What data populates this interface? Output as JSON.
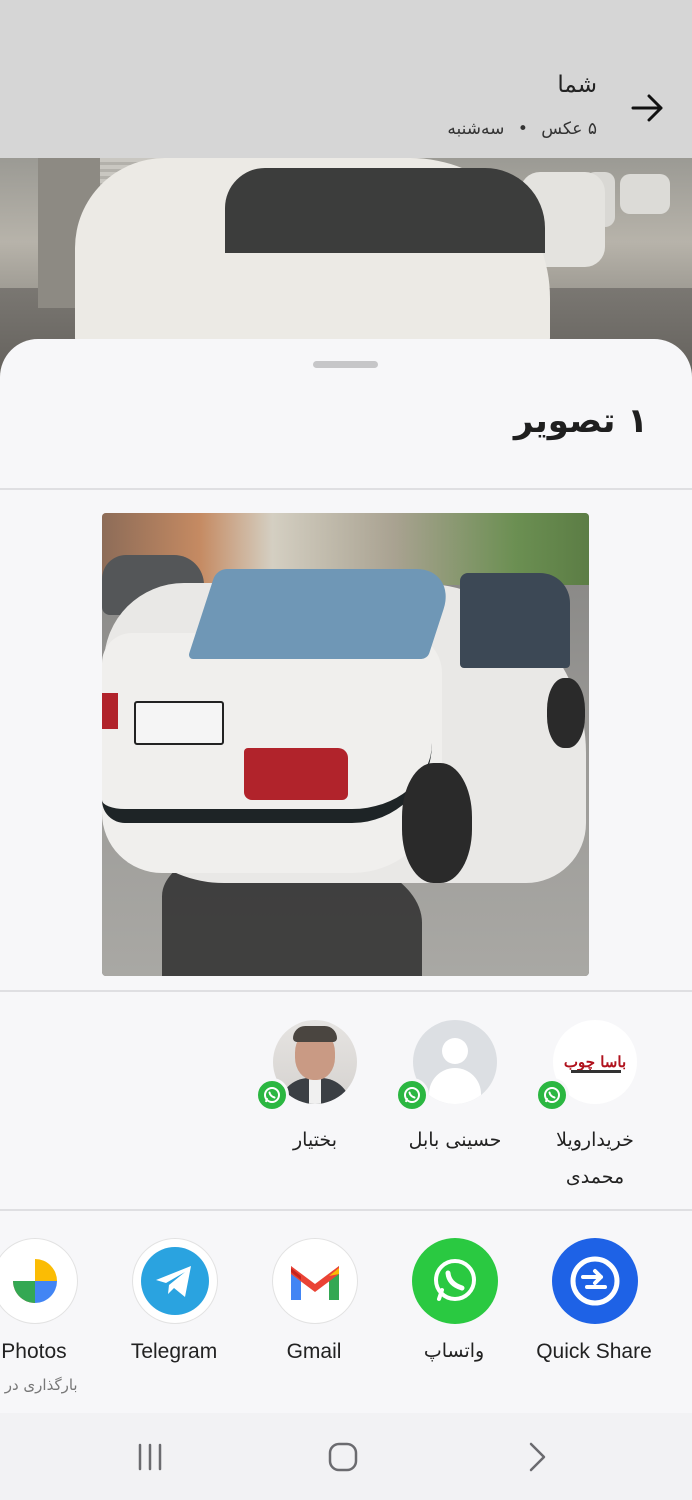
{
  "header": {
    "title": "شما",
    "photo_count": "۵ عکس",
    "separator": "•",
    "day": "سه‌شنبه"
  },
  "sheet": {
    "title": "۱ تصویر"
  },
  "contacts": [
    {
      "name": "خریدارویلا محمدی",
      "avatar": "logo",
      "badge_icon": "whatsapp-icon"
    },
    {
      "name": "حسینی بابل",
      "avatar": "generic-person",
      "badge_icon": "whatsapp-icon"
    },
    {
      "name": "بختیار",
      "avatar": "photo-person",
      "badge_icon": "whatsapp-icon"
    }
  ],
  "apps": [
    {
      "label": "Quick Share",
      "icon": "quick-share-icon"
    },
    {
      "label": "واتساپ",
      "icon": "whatsapp-icon"
    },
    {
      "label": "Gmail",
      "icon": "gmail-icon"
    },
    {
      "label": "Telegram",
      "icon": "telegram-icon"
    },
    {
      "label": "Photos",
      "sublabel": "بارگذاری در ..",
      "icon": "google-photos-icon"
    }
  ],
  "navbar": {
    "buttons": [
      "recents",
      "home",
      "back"
    ]
  },
  "colors": {
    "whatsapp": "#2ac941",
    "quick_share": "#1e62e6",
    "sheet_bg": "#f7f7f9"
  }
}
